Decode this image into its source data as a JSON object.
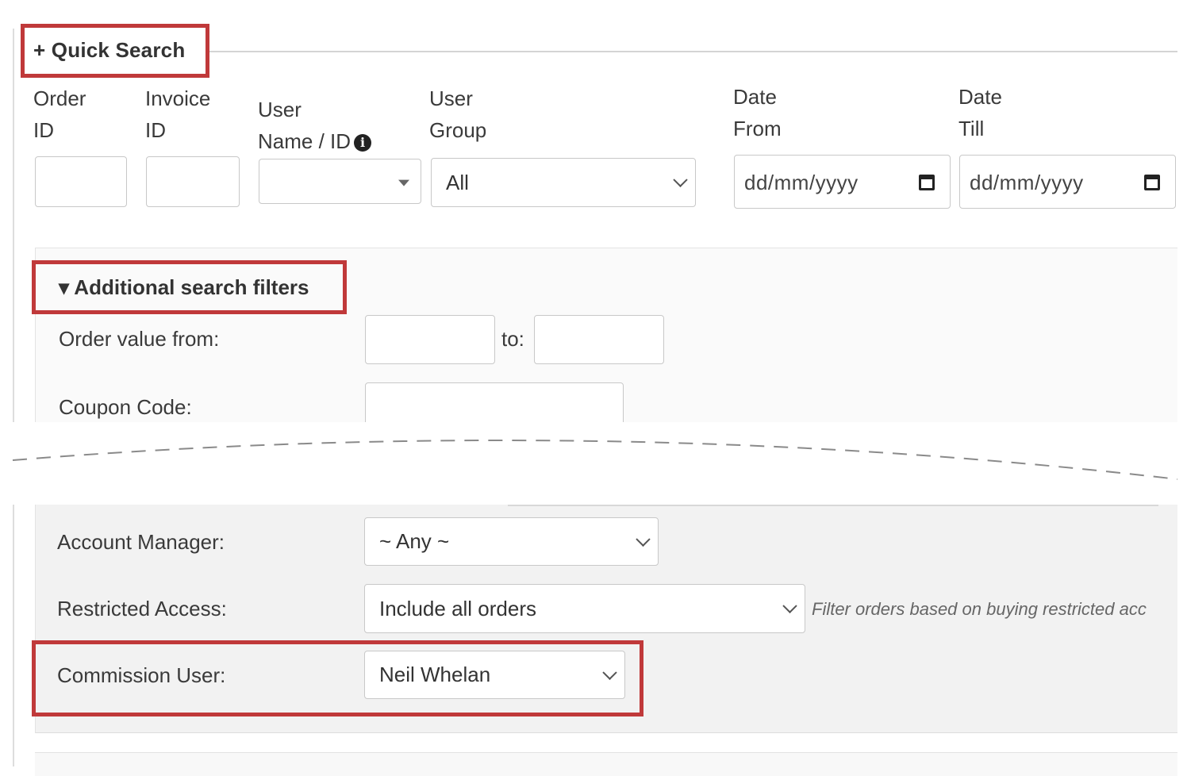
{
  "quick_search": {
    "legend": "+ Quick Search",
    "order_id_label_1": "Order",
    "order_id_label_2": "ID",
    "invoice_id_label_1": "Invoice",
    "invoice_id_label_2": "ID",
    "user_label_1": "User",
    "user_label_2": "Name / ID",
    "user_info_icon": "info-icon",
    "user_group_label_1": "User",
    "user_group_label_2": "Group",
    "user_group_value": "All",
    "date_from_label_1": "Date",
    "date_from_label_2": "From",
    "date_from_placeholder": "dd/mm/yyyy",
    "date_till_label_1": "Date",
    "date_till_label_2": "Till",
    "date_till_placeholder": "dd/mm/yyyy"
  },
  "additional": {
    "toggle": "▾ Additional search filters",
    "order_value_from_label": "Order value from:",
    "to_label": "to:",
    "coupon_code_label": "Coupon Code:",
    "account_manager_label": "Account Manager:",
    "account_manager_value": "~ Any ~",
    "restricted_access_label": "Restricted Access:",
    "restricted_access_value": "Include all orders",
    "restricted_access_help": "Filter orders based on buying restricted acc",
    "commission_user_label": "Commission User:",
    "commission_user_value": "Neil Whelan"
  },
  "colors": {
    "highlight": "#c0393a",
    "panel": "#f2f2f2"
  }
}
